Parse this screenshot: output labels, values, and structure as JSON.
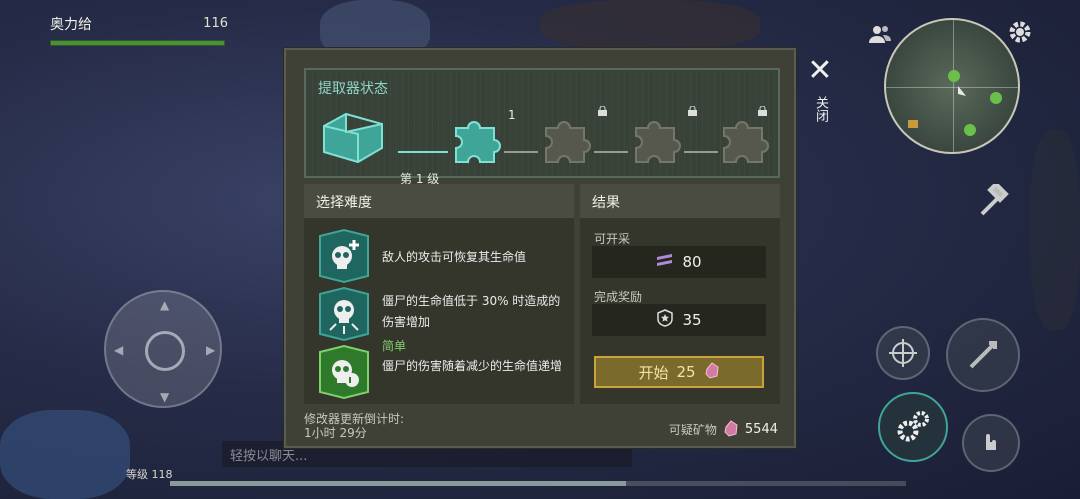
{
  "player": {
    "name": "奥力给",
    "level_number": "116",
    "health_fraction": 0.96
  },
  "hud": {
    "close_label": "关闭",
    "chat_placeholder": "轻按以聊天...",
    "xp_level_label": "等级 118",
    "xp_fraction": 0.62
  },
  "extractor": {
    "status_title": "提取器状态",
    "tier_label": "第 1 级",
    "stage_count_label": "1",
    "stages": [
      {
        "state": "active"
      },
      {
        "state": "unlocked"
      },
      {
        "state": "locked"
      },
      {
        "state": "locked"
      },
      {
        "state": "locked"
      }
    ]
  },
  "difficulty": {
    "title": "选择难度",
    "modifiers": [
      {
        "icon": "skull-plus-icon",
        "text": "敌人的攻击可恢复其生命值"
      },
      {
        "icon": "skull-burst-icon",
        "text": "僵尸的生命值低于 30% 时造成的伤害增加"
      },
      {
        "icon": "skull-shield-icon",
        "title": "简单",
        "text": "僵尸的伤害随着减少的生命值递增"
      }
    ]
  },
  "result": {
    "title": "结果",
    "mineable_label": "可开采",
    "mineable_value": "80",
    "reward_label": "完成奖励",
    "reward_value": "35",
    "start_label": "开始",
    "start_cost": "25"
  },
  "footer": {
    "timer_label": "修改器更新倒计时:",
    "timer_value": "1小时 29分",
    "ore_label": "可疑矿物",
    "ore_value": "5544"
  },
  "colors": {
    "accent_teal": "#3ea598",
    "start_gold": "#c9a43a",
    "easy_green": "#7fd06a"
  }
}
